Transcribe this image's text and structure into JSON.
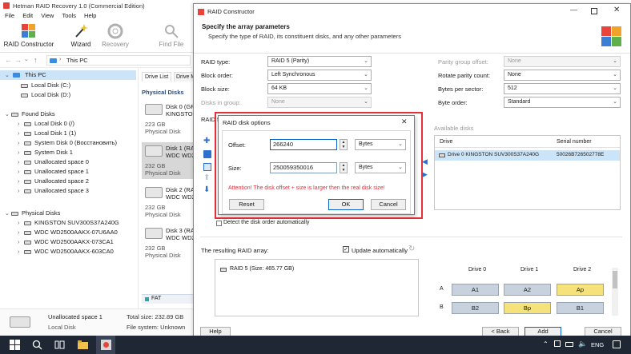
{
  "app": {
    "title": "Hetman RAID Recovery 1.0 (Commercial Edition)",
    "menu": [
      "File",
      "Edit",
      "View",
      "Tools",
      "Help"
    ],
    "ribbon": {
      "raid_constructor": "RAID Constructor",
      "wizard": "Wizard",
      "recovery": "Recovery",
      "find_file": "Find File"
    },
    "address": "This PC",
    "tabs": {
      "drive_list": "Drive List",
      "drive_map": "Drive M"
    }
  },
  "tree": {
    "this_pc": "This PC",
    "this_pc_items": [
      "Local Disk (C:)",
      "Local Disk (D:)"
    ],
    "found_disks": "Found Disks",
    "found_items": [
      "Local Disk 0 (/)",
      "Local Disk 1 (1)",
      "System Disk 0 (Восстановить)",
      "System Disk 1",
      "Unallocated space 0",
      "Unallocated space 1",
      "Unallocated space 2",
      "Unallocated space 3"
    ],
    "physical_disks": "Physical Disks",
    "physical_items": [
      "KINGSTON SUV300S37A240G",
      "WDC WD2500AAKX-07U6AA0",
      "WDC WD2500AAKX-073CA1",
      "WDC WD2500AAKX-603CA0"
    ]
  },
  "mid": {
    "heading": "Physical Disks",
    "cards": [
      {
        "name": "Disk 0 (GPT)",
        "model": "KINGSTON",
        "size": "223 GB",
        "type": "Physical Disk"
      },
      {
        "name": "Disk 1 (RAW)",
        "model": "WDC WD25",
        "size": "232 GB",
        "type": "Physical Disk"
      },
      {
        "name": "Disk 2 (RAW)",
        "model": "WDC WD25",
        "size": "232 GB",
        "type": "Physical Disk"
      },
      {
        "name": "Disk 3 (RAW)",
        "model": "WDC WD25",
        "size": "232 GB",
        "type": "Physical Disk"
      }
    ],
    "fat": "FAT"
  },
  "bottom_info": {
    "name": "Unallocated space 1",
    "type": "Local Disk",
    "total_label": "Total size: 232.89 GB",
    "fs_label": "File system: Unknown"
  },
  "ctor": {
    "title": "RAID Constructor",
    "header_title": "Specify the array parameters",
    "header_sub": "Specify the type of RAID, its constituent disks, and any other parameters",
    "left_fields": [
      {
        "label": "RAID type:",
        "value": "RAID 5 (Parity)"
      },
      {
        "label": "Block order:",
        "value": "Left Synchronous"
      },
      {
        "label": "Block size:",
        "value": "64 KB"
      },
      {
        "label": "Disks in group:",
        "value": "None"
      }
    ],
    "right_fields": [
      {
        "label": "Parity group offset:",
        "value": "None"
      },
      {
        "label": "Rotate parity count:",
        "value": "None"
      },
      {
        "label": "Bytes per sector:",
        "value": "512"
      },
      {
        "label": "Byte order:",
        "value": "Standard"
      }
    ],
    "raid_section_label": "RAID 5",
    "available_label": "Available disks",
    "available_cols": [
      "Drive",
      "Serial number"
    ],
    "available_row": {
      "drive": "Drive 0 KINGSTON SUV300S37A240G",
      "serial": "50026B726502778E"
    },
    "detect_label": "Detect the disk order automatically",
    "result_label": "The resulting RAID array:",
    "update_label": "Update automatically",
    "result_item": "RAID 5 (Size: 465.77 GB)",
    "grid_cols": [
      "Drive 0",
      "Drive 1",
      "Drive 2"
    ],
    "grid_rows": [
      {
        "label": "A",
        "cells": [
          "A1",
          "A2",
          "Ap"
        ]
      },
      {
        "label": "B",
        "cells": [
          "B2",
          "Bp",
          "B1"
        ]
      }
    ],
    "buttons": {
      "help": "Help",
      "back": "< Back",
      "add": "Add",
      "cancel": "Cancel"
    }
  },
  "dialog": {
    "title": "RAID disk options",
    "offset_label": "Offset:",
    "offset_value": "266240",
    "offset_unit": "Bytes",
    "size_label": "Size:",
    "size_value": "250059350016",
    "size_unit": "Bytes",
    "warning": "Attention! The disk offset + size is larger then the real disk size!",
    "buttons": {
      "reset": "Reset",
      "ok": "OK",
      "cancel": "Cancel"
    }
  },
  "taskbar": {
    "lang": "ENG"
  },
  "colors": {
    "accent": "#0a63c9",
    "warning": "#e6303a",
    "grid_blue": "#c7d2de",
    "grid_yellow": "#f6e27a",
    "taskbar": "#1f2735"
  }
}
